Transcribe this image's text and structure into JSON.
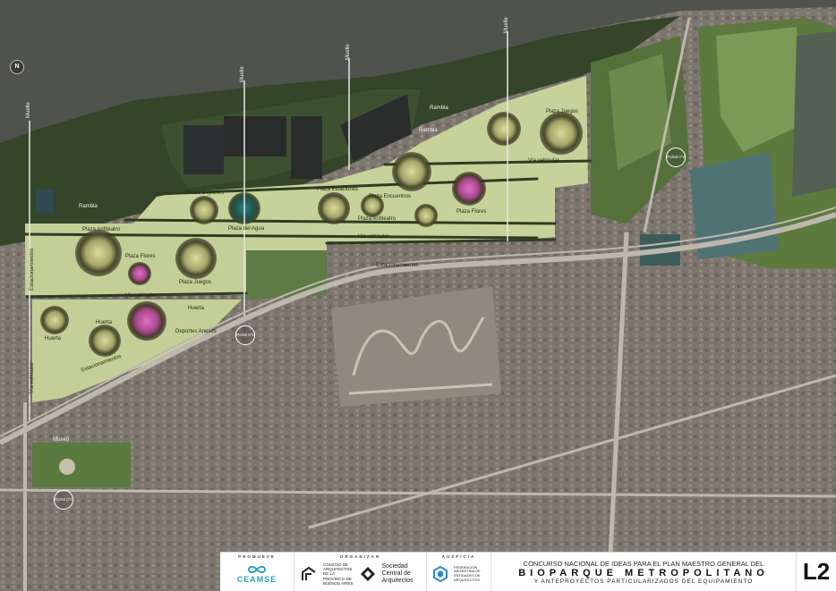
{
  "map": {
    "labels": {
      "muelle": "Muelle",
      "rambla": "Rambla",
      "plaza_juegos": "Plaza Juegos",
      "plaza_deportes": "Plaza Deportes",
      "plaza_estaciones": "Plaza Estaciones",
      "plaza_anfiteatro": "Plaza Anfiteatro",
      "plaza_encuentros": "Plaza Encuentros",
      "plaza_flores": "Plaza Flores",
      "plaza_agua": "Plaza del Agua",
      "via_vehicular": "Vía vehicular",
      "estacionamientos": "Estacionamientos",
      "huerta": "Huerta",
      "deportes_anexos": "Deportes Anexos",
      "museo": "Museo",
      "portal_1": "Portal nº1",
      "portal_2": "Portal nº2",
      "portal_3": "Portal nº3",
      "north": "N"
    }
  },
  "footer": {
    "promueve": "PROMUEVE",
    "organizan": "ORGANIZAN",
    "auspicia": "AUSPICIA",
    "ceamse": "CEAMSE",
    "colegio": [
      "COLEGIO DE",
      "ARQUITECTOS",
      "DE LA",
      "PROVINCIA DE",
      "BUENOS AIRES"
    ],
    "sca": [
      "Sociedad",
      "Central de",
      "Arquitectos"
    ],
    "fadea": [
      "FEDERACIÓN",
      "ARGENTINA DE",
      "ENTIDADES DE",
      "ARQUITECTOS"
    ],
    "title_line1": "CONCURSO NACIONAL DE IDEAS PARA EL PLAN MAESTRO GENERAL DEL",
    "title_line2": "BIOPARQUE METROPOLITANO",
    "title_line3": "Y ANTEPROYECTOS PARTICULARIZADOS DEL EQUIPAMIENTO",
    "sheet_code": "L2"
  },
  "colors": {
    "water": "#4e514c",
    "city": "#7b736c",
    "park": "#c9d49a",
    "forest": "#2e3d22"
  }
}
